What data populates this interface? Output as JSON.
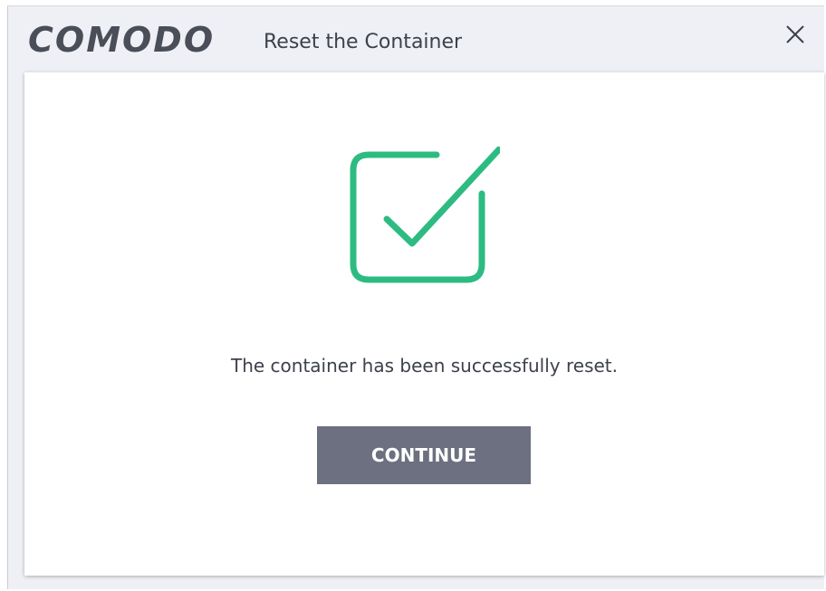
{
  "window": {
    "logo_text": "COMODO",
    "title": "Reset the Container",
    "close_icon": "close-icon"
  },
  "content": {
    "status_icon": "checkbox-checked-icon",
    "message": "The container has been successfully reset.",
    "continue_label": "CONTINUE"
  },
  "colors": {
    "accent_green": "#2dbb82",
    "button_gray": "#6c7080",
    "titlebar_bg": "#eef0f5",
    "logo_color": "#4a4e59"
  }
}
